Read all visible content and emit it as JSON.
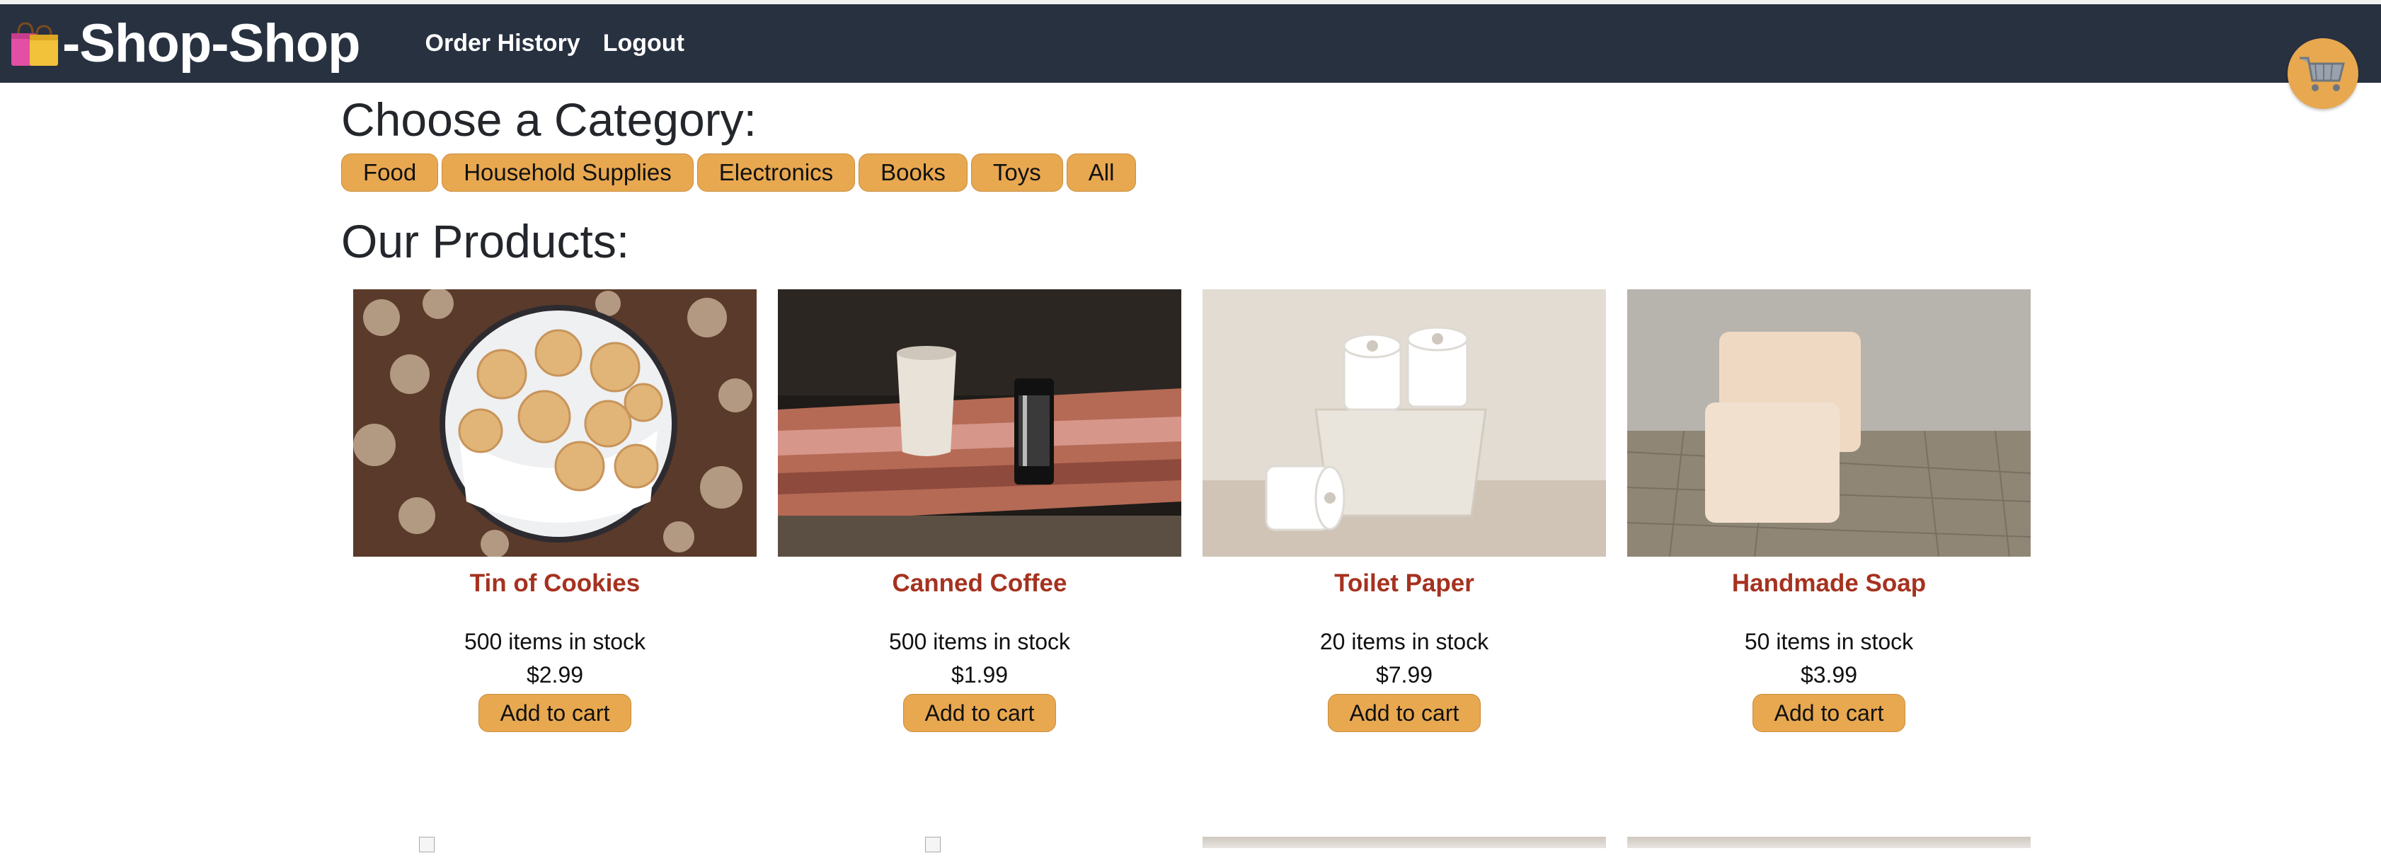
{
  "header": {
    "brand_icon": "shopping-bags-icon",
    "brand_title": "-Shop-Shop",
    "nav": [
      "Order History",
      "Logout"
    ],
    "cart_icon": "shopping-cart-icon"
  },
  "categories": {
    "title": "Choose a Category:",
    "items": [
      "Food",
      "Household Supplies",
      "Electronics",
      "Books",
      "Toys",
      "All"
    ]
  },
  "products": {
    "title": "Our Products:",
    "items": [
      {
        "name": "Tin of Cookies",
        "stock": "500 items in stock",
        "price": "$2.99",
        "button": "Add to cart",
        "image": "cookies-tin-photo"
      },
      {
        "name": "Canned Coffee",
        "stock": "500 items in stock",
        "price": "$1.99",
        "button": "Add to cart",
        "image": "canned-coffee-photo"
      },
      {
        "name": "Toilet Paper",
        "stock": "20 items in stock",
        "price": "$7.99",
        "button": "Add to cart",
        "image": "toilet-paper-photo"
      },
      {
        "name": "Handmade Soap",
        "stock": "50 items in stock",
        "price": "$3.99",
        "button": "Add to cart",
        "image": "soap-photo"
      }
    ]
  },
  "colors": {
    "header_bg": "#283140",
    "accent": "#e8a850",
    "product_name": "#a5321f"
  }
}
